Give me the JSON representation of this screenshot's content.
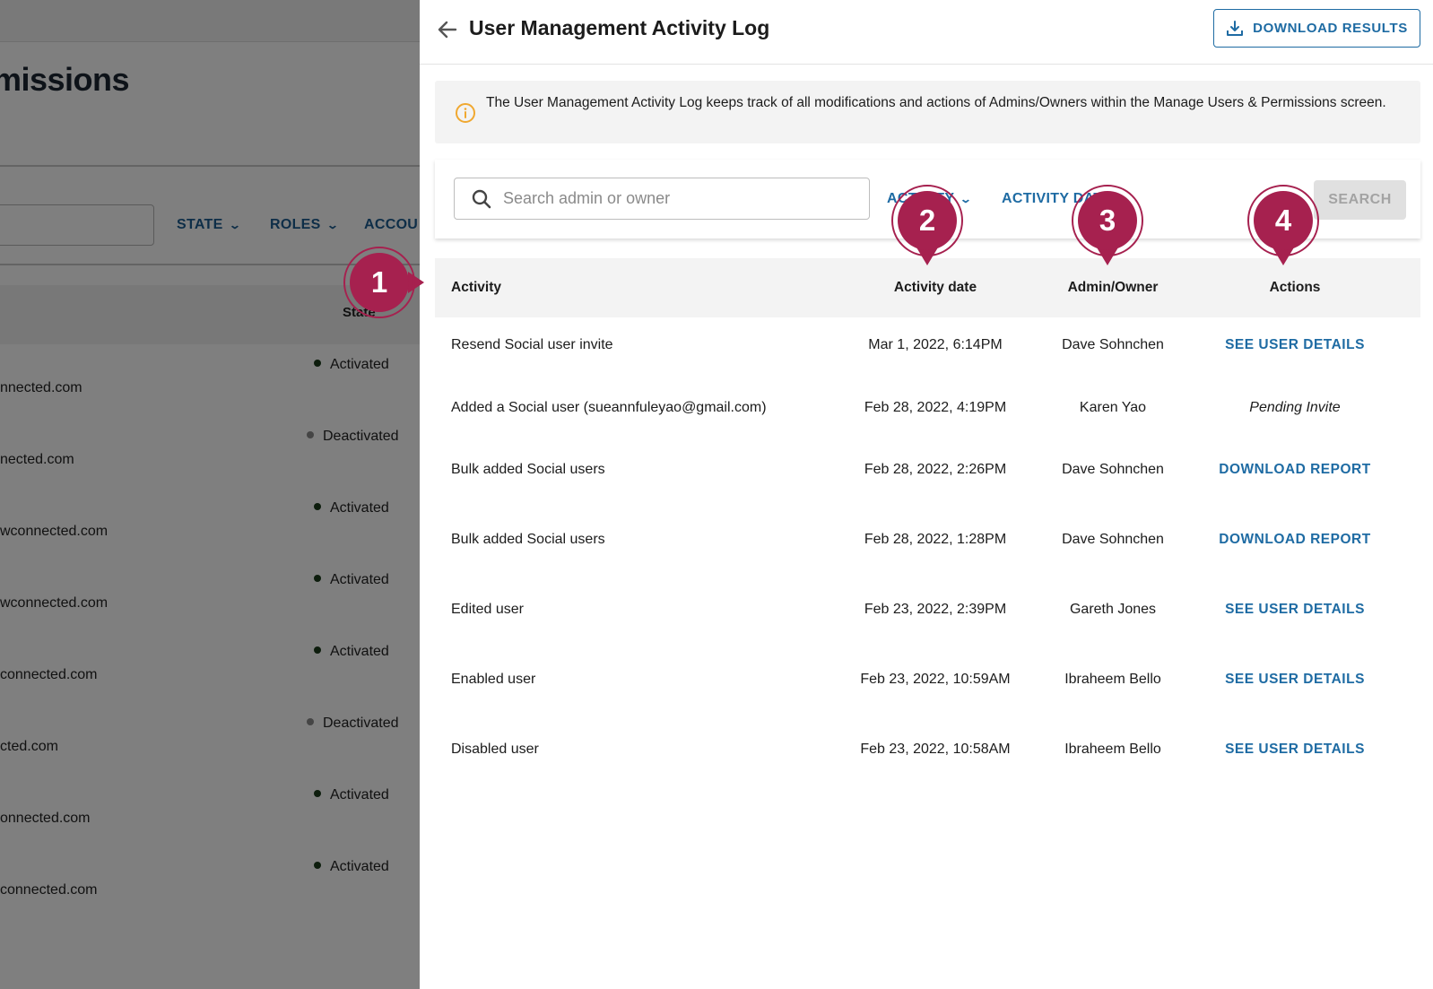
{
  "background_page": {
    "title": "missions",
    "filters": [
      {
        "label": "STATE"
      },
      {
        "label": "ROLES"
      },
      {
        "label": "ACCOU"
      }
    ],
    "state_header": "State",
    "rows": [
      {
        "email": "nnected.com",
        "state": "Activated",
        "dot_color": "#1a3a1a"
      },
      {
        "email": "nected.com",
        "state": "Deactivated",
        "dot_color": "#8a8a8a"
      },
      {
        "email": "wconnected.com",
        "state": "Activated",
        "dot_color": "#1a3a1a"
      },
      {
        "email": "wconnected.com",
        "state": "Activated",
        "dot_color": "#1a3a1a"
      },
      {
        "email": "connected.com",
        "state": "Activated",
        "dot_color": "#1a3a1a"
      },
      {
        "email": "cted.com",
        "state": "Deactivated",
        "dot_color": "#8a8a8a"
      },
      {
        "email": "onnected.com",
        "state": "Activated",
        "dot_color": "#1a3a1a"
      },
      {
        "email": "connected.com",
        "state": "Activated",
        "dot_color": "#1a3a1a"
      }
    ]
  },
  "drawer": {
    "title": "User Management Activity Log",
    "download_results_label": "DOWNLOAD RESULTS",
    "info_text": "The User Management Activity Log keeps track of all modifications and actions of Admins/Owners within the Manage Users & Permissions screen.",
    "search_placeholder": "Search admin or owner",
    "filter_activity_label": "ACTIVITY",
    "filter_activity_date_label": "ACTIVITY DATE",
    "search_button_label": "SEARCH",
    "columns": {
      "activity": "Activity",
      "activity_date": "Activity date",
      "admin_owner": "Admin/Owner",
      "actions": "Actions"
    },
    "rows": [
      {
        "activity": "Resend Social user invite",
        "date": "Mar 1, 2022, 6:14PM",
        "admin": "Dave Sohnchen",
        "action": "SEE USER DETAILS",
        "action_type": "link"
      },
      {
        "activity": "Added a Social user (sueannfuleyao@gmail.com)",
        "date": "Feb 28, 2022, 4:19PM",
        "admin": "Karen Yao",
        "action": "Pending Invite",
        "action_type": "status"
      },
      {
        "activity": "Bulk added Social users",
        "date": "Feb 28, 2022, 2:26PM",
        "admin": "Dave Sohnchen",
        "action": "DOWNLOAD REPORT",
        "action_type": "link"
      },
      {
        "activity": "Bulk added Social users",
        "date": "Feb 28, 2022, 1:28PM",
        "admin": "Dave Sohnchen",
        "action": "DOWNLOAD REPORT",
        "action_type": "link"
      },
      {
        "activity": "Edited user",
        "date": "Feb 23, 2022, 2:39PM",
        "admin": "Gareth Jones",
        "action": "SEE USER DETAILS",
        "action_type": "link"
      },
      {
        "activity": "Enabled user",
        "date": "Feb 23, 2022, 10:59AM",
        "admin": "Ibraheem Bello",
        "action": "SEE USER DETAILS",
        "action_type": "link"
      },
      {
        "activity": "Disabled user",
        "date": "Feb 23, 2022, 10:58AM",
        "admin": "Ibraheem Bello",
        "action": "SEE USER DETAILS",
        "action_type": "link"
      }
    ]
  },
  "callouts": [
    {
      "number": "1"
    },
    {
      "number": "2"
    },
    {
      "number": "3"
    },
    {
      "number": "4"
    }
  ],
  "colors": {
    "accent_link": "#1e6ba3",
    "callout": "#a6214f",
    "info_icon": "#f0a830"
  },
  "icons": {
    "back": "arrow-left-icon",
    "download": "download-icon",
    "info": "info-circle-icon",
    "search": "search-icon",
    "chevron": "chevron-down-icon"
  }
}
